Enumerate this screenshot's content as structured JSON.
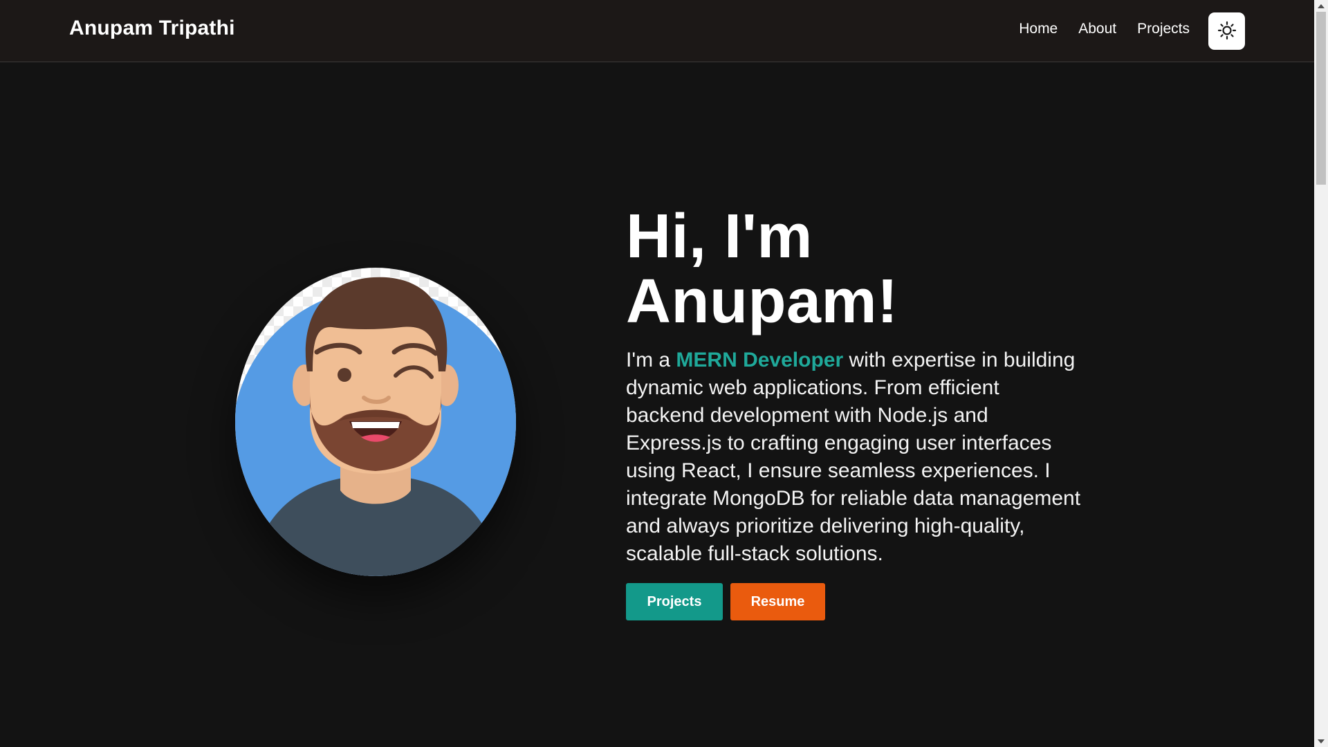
{
  "header": {
    "brand": "Anupam Tripathi",
    "nav": {
      "home": "Home",
      "about": "About",
      "projects": "Projects"
    },
    "theme_toggle_icon": "sun-icon"
  },
  "hero": {
    "avatar_icon": "avatar-illustration",
    "title_line1": "Hi, I'm",
    "title_line2": "Anupam!",
    "desc_prefix": "I'm a ",
    "desc_role": "MERN Developer",
    "desc_body": " with expertise in building dynamic web applications. From efficient backend development with Node.js and Express.js to crafting engaging user interfaces using React, I ensure seamless experiences. I integrate MongoDB for reliable data management and always prioritize delivering high-quality, scalable full-stack solutions.",
    "buttons": {
      "projects": "Projects",
      "resume": "Resume"
    }
  },
  "colors": {
    "background": "#131313",
    "navbar": "#1c1817",
    "accent_teal": "#1fa99a",
    "projects_button": "#13998a",
    "resume_button": "#ea5b0e"
  }
}
